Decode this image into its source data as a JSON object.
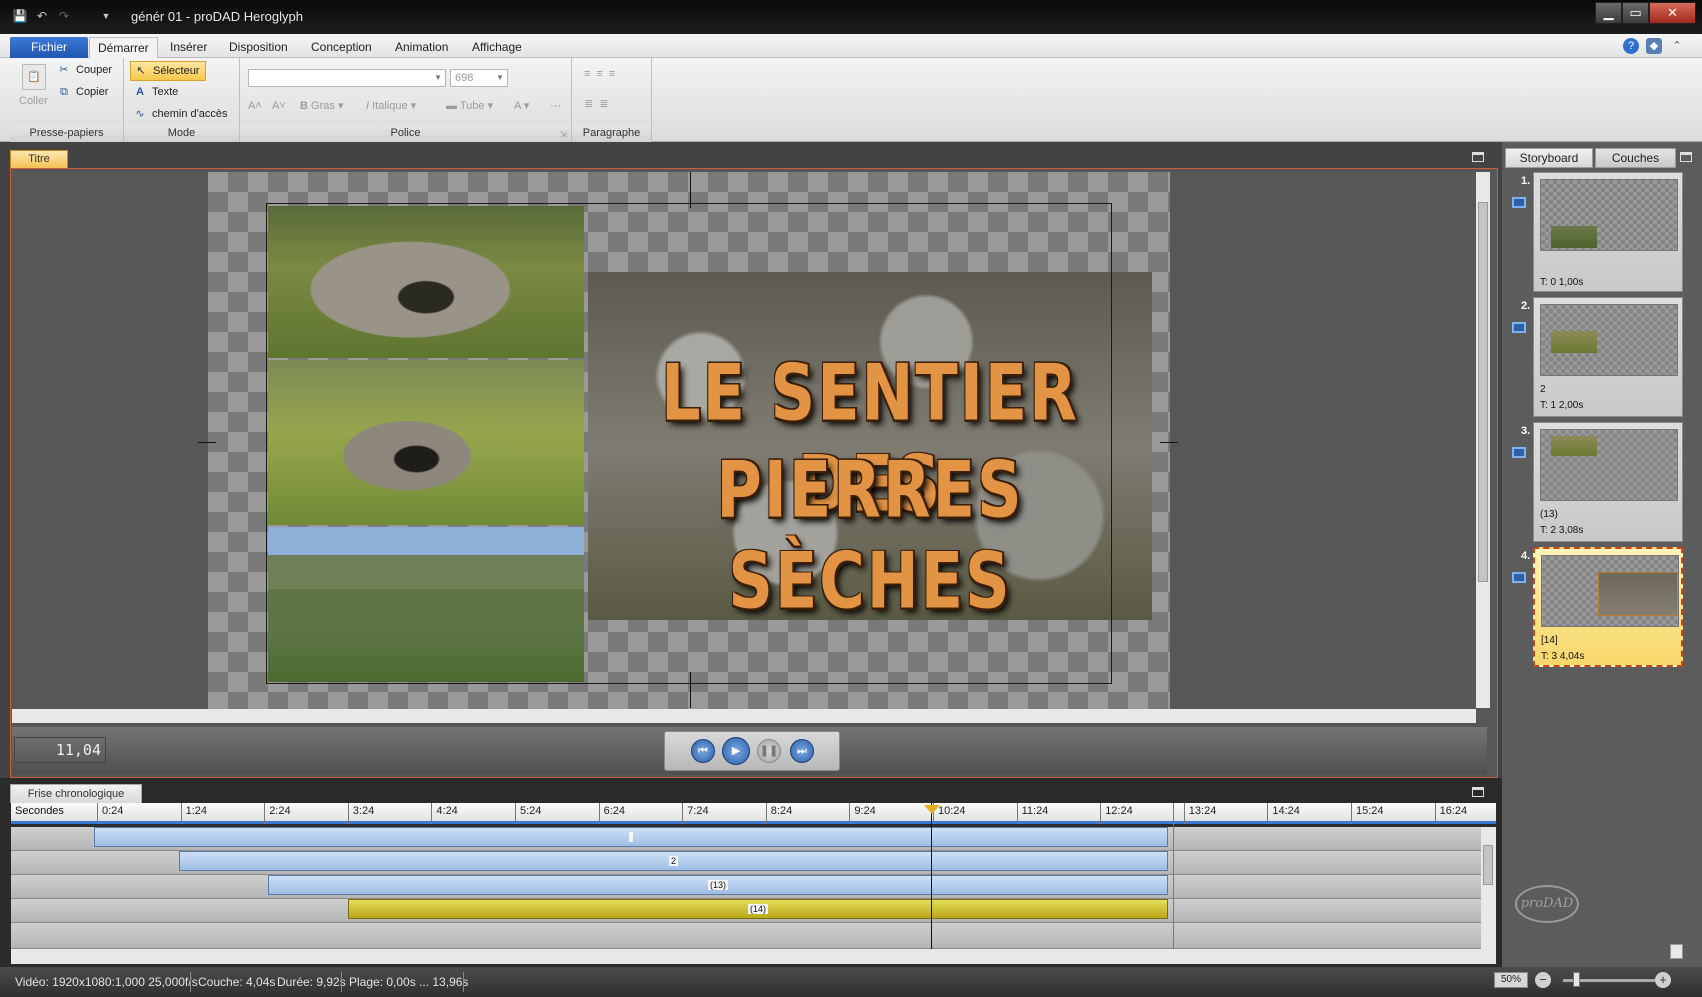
{
  "window": {
    "title": "génér 01 - proDAD Heroglyph",
    "minimize": "▁",
    "maximize": "▭",
    "close": "✕"
  },
  "ribbon_tabs": [
    "Fichier",
    "Démarrer",
    "Insérer",
    "Disposition",
    "Conception",
    "Animation",
    "Affichage"
  ],
  "ribbon": {
    "clipboard": {
      "paste": "Coller",
      "cut": "Couper",
      "copy": "Copier",
      "label": "Presse-papiers"
    },
    "mode": {
      "selector": "Sélecteur",
      "text": "Texte",
      "path": "chemin d'accès",
      "label": "Mode"
    },
    "font": {
      "size": "698",
      "bold": "Gras",
      "italic": "Italique",
      "tube": "Tube",
      "label": "Police"
    },
    "paragraph": {
      "label": "Paragraphe"
    }
  },
  "panels": {
    "title_tab": "Titre",
    "timeline_tab": "Frise chronologique",
    "storyboard_tab": "Storyboard",
    "layers_tab": "Couches"
  },
  "preview": {
    "title_line1": "LE SENTIER DES",
    "title_line2": "PIERRES SÈCHES",
    "time": "11,04"
  },
  "timeline": {
    "ruler_label": "Secondes",
    "ticks": [
      "0:24",
      "1:24",
      "2:24",
      "3:24",
      "4:24",
      "5:24",
      "6:24",
      "7:24",
      "8:24",
      "9:24",
      "10:24",
      "11:24",
      "12:24",
      "13:24",
      "14:24",
      "15:24",
      "16:24"
    ],
    "clips": [
      {
        "label": ""
      },
      {
        "label": "2"
      },
      {
        "label": "(13)"
      },
      {
        "label": "(14)"
      }
    ]
  },
  "storyboard": [
    {
      "num": "1.",
      "name": "",
      "info": "T: 0  1,00s"
    },
    {
      "num": "2.",
      "name": "2",
      "info": "T: 1  2,00s"
    },
    {
      "num": "3.",
      "name": "(13)",
      "info": "T: 2  3,08s"
    },
    {
      "num": "4.",
      "name": "[14]",
      "info": "T: 3  4,04s"
    }
  ],
  "logo": "proDAD",
  "status": {
    "video": "Vidéo: 1920x1080:1,000  25,000f/s",
    "layer": "Couche: 4,04s",
    "duration": "Durée: 9,92s",
    "range": "Plage: 0,00s ... 13,96s",
    "zoom": "50%"
  },
  "colors": {
    "accent": "#1f55b3",
    "selected_clip": "#c9b928",
    "clip": "#a9c6ec",
    "selection_border": "#d05b3a"
  }
}
